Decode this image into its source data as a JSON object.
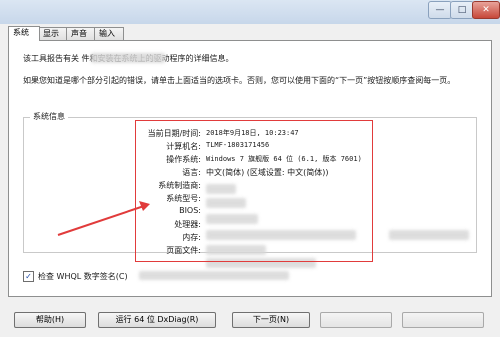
{
  "window": {
    "minimize_glyph": "—",
    "maximize_glyph": "□",
    "close_glyph": "✕"
  },
  "tabs": [
    {
      "label": "系统",
      "active": true
    },
    {
      "label": "显示",
      "active": false
    },
    {
      "label": "声音",
      "active": false
    },
    {
      "label": "输入",
      "active": false
    }
  ],
  "intro": {
    "line1": "该工具报告有关                    件和安装在系统上的驱动程序的详细信息。",
    "line2": "如果您知道是哪个部分引起的错误，请单击上面适当的选项卡。否则，您可以使用下面的“下一页”按钮按顺序查阅每一页。"
  },
  "system_info": {
    "group_title": "系统信息",
    "rows": [
      {
        "label": "当前日期/时间:",
        "value": "2018年9月18日, 10:23:47"
      },
      {
        "label": "计算机名:",
        "value": "TLMF-1803171456"
      },
      {
        "label": "操作系统:",
        "value": "Windows 7 旗舰版 64 位 (6.1, 版本 7601)"
      },
      {
        "label": "语言:",
        "value": "中文(简体) (区域设置: 中文(简体))"
      },
      {
        "label": "系统制造商:",
        "value": ""
      },
      {
        "label": "系统型号:",
        "value": ""
      },
      {
        "label": "BIOS:",
        "value": ""
      },
      {
        "label": "处理器:",
        "value": ""
      },
      {
        "label": "内存:",
        "value": ""
      },
      {
        "label": "页面文件:",
        "value": ""
      }
    ]
  },
  "whql": {
    "label": "检查 WHQL 数字签名(C)",
    "checked": true,
    "check_glyph": "✓"
  },
  "buttons": {
    "help": "帮助(H)",
    "run64": "运行 64 位 DxDiag(R)",
    "next": "下一页(N)"
  },
  "colors": {
    "highlight_box": "#e13b3b",
    "arrow": "#e13b3b"
  }
}
